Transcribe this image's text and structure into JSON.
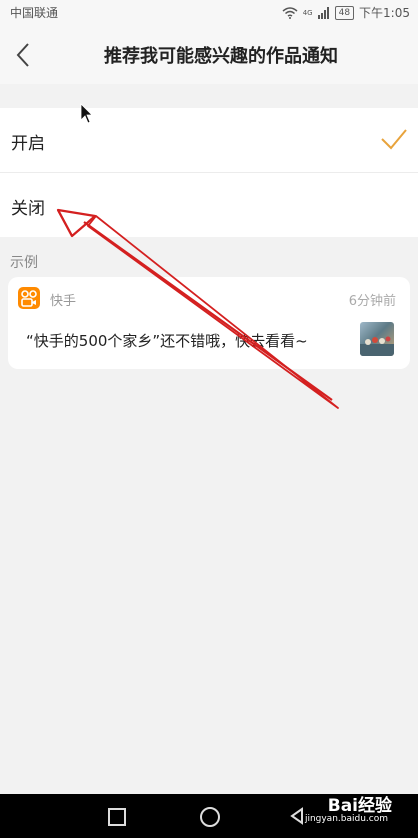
{
  "statusbar": {
    "carrier": "中国联通",
    "network": "4G",
    "battery": "48",
    "time": "下午1:05"
  },
  "appbar": {
    "title": "推荐我可能感兴趣的作品通知",
    "back_icon": "chevron-left-icon"
  },
  "options": [
    {
      "label": "开启",
      "selected": true
    },
    {
      "label": "关闭",
      "selected": false
    }
  ],
  "example": {
    "section_label": "示例",
    "app_name": "快手",
    "time": "6分钟前",
    "message": "“快手的500个家乡”还不错哦，快去看看~"
  },
  "watermark": {
    "brand": "Bai经验",
    "site": "jingyan.baidu.com"
  },
  "colors": {
    "accent": "#e8a33c",
    "annotation": "#d42020",
    "app_icon": "#ff8a00"
  }
}
